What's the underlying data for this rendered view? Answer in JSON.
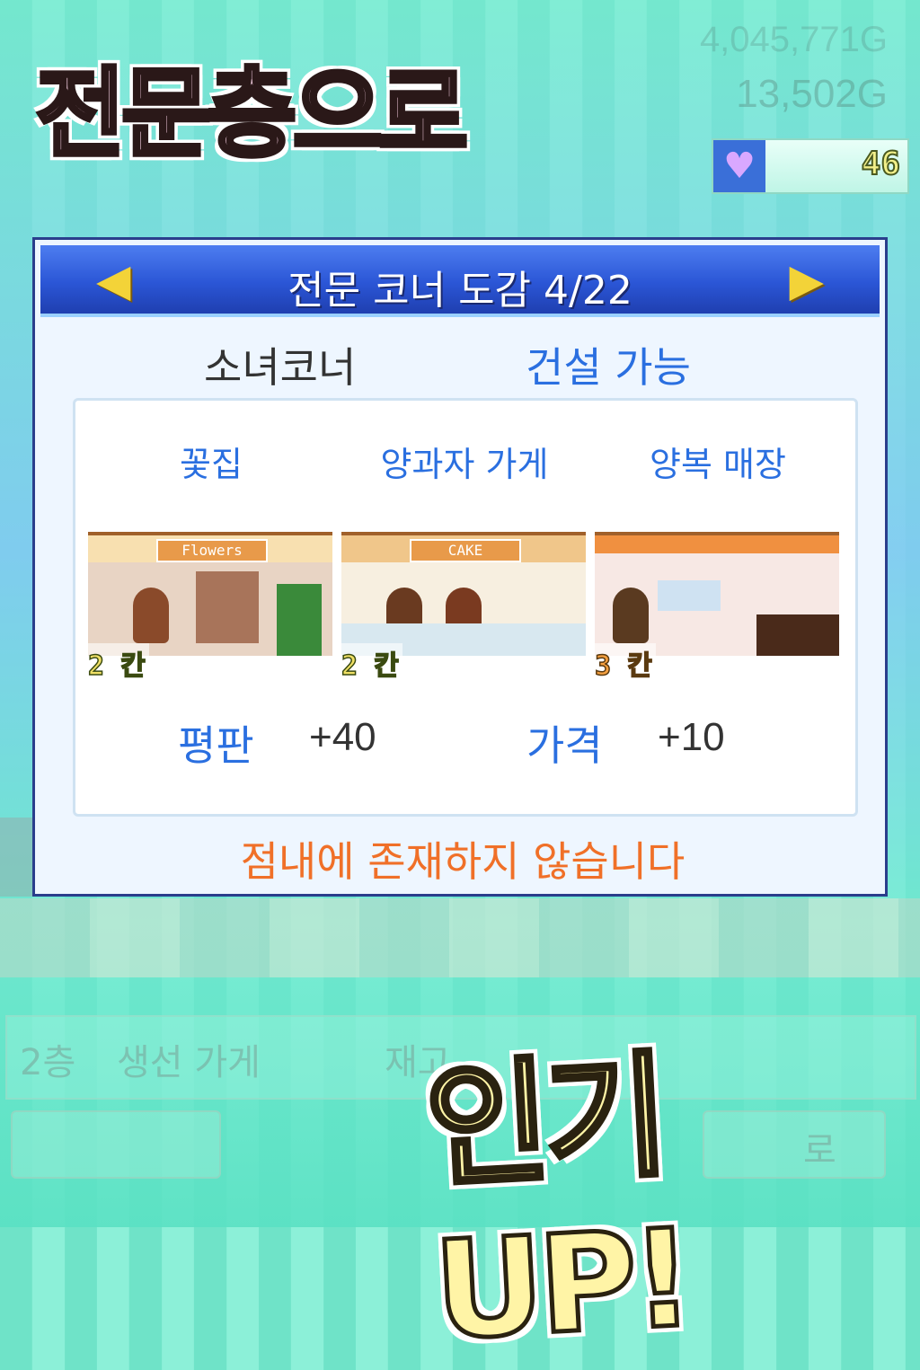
{
  "background": {
    "gold_faded_top": "4,045,771G",
    "gold": "13,502G",
    "floor_label": "2층",
    "shop_label": "생선 가게",
    "partial_label": "재고",
    "partial_button": "로"
  },
  "status": {
    "hearts": "46",
    "heart_icon": "heart-icon"
  },
  "promo": {
    "headline": "전문층으로",
    "tagline": "인기 UP!"
  },
  "dialog": {
    "title": "전문 코너 도감 4/22",
    "corner_name": "소녀코너",
    "build_status": "건설 가능",
    "stores": [
      {
        "label": "꽃집",
        "size": "2 칸",
        "sign": "Flowers"
      },
      {
        "label": "양과자 가게",
        "size": "2 칸",
        "sign": "CAKE"
      },
      {
        "label": "양복 매장",
        "size": "3 칸",
        "sign": ""
      }
    ],
    "stats": [
      {
        "label": "평판",
        "value": "+40"
      },
      {
        "label": "가격",
        "value": "+10"
      }
    ],
    "notice": "점내에 존재하지 않습니다"
  },
  "colors": {
    "accent_blue": "#2a6fe0",
    "notice_orange": "#f07028",
    "header_blue": "#2b56d6"
  }
}
